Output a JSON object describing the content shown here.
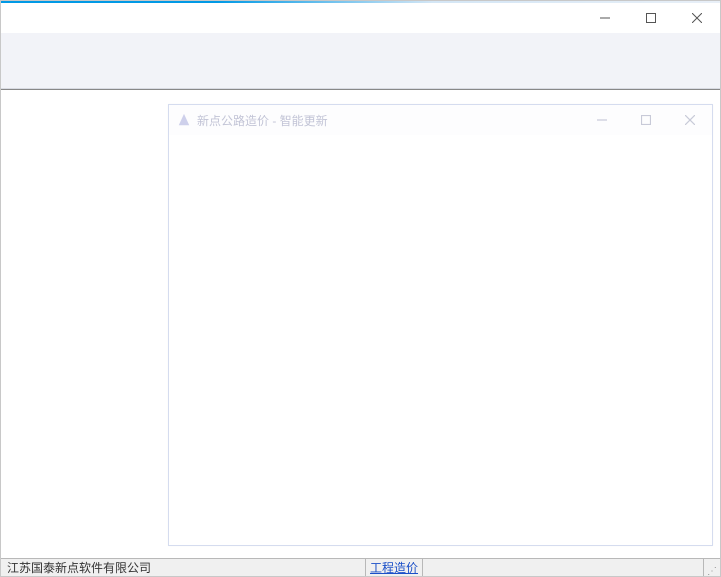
{
  "main_window": {
    "title": ""
  },
  "inner_dialog": {
    "title": "新点公路造价 - 智能更新"
  },
  "statusbar": {
    "company": "江苏国泰新点软件有限公司",
    "link": "工程造价"
  }
}
